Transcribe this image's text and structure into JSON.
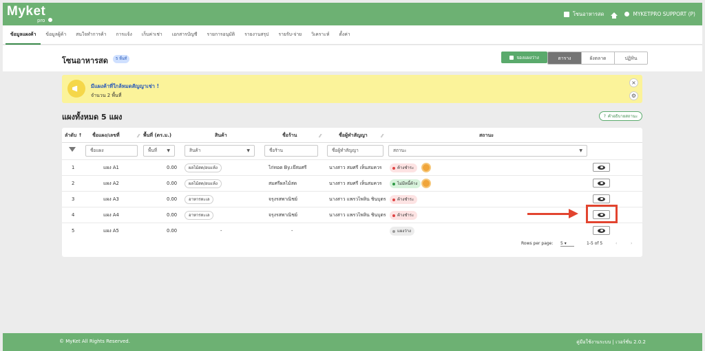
{
  "app": {
    "logo": "Myket",
    "logo_sub": "pro"
  },
  "topbar": {
    "zone": "โซนอาหารสด",
    "user": "MYKETPRO SUPPORT (P)"
  },
  "nav": [
    "ข้อมูลแผงค้า",
    "ข้อมูลผู้ค้า",
    "สนใจทำการค้า",
    "การแจ้ง",
    "เก็บค่าเช่า",
    "เอกสารบัญชี",
    "รายการอนุมัติ",
    "รายงานสรุป",
    "รายรับ-จ่าย",
    "วิเคราะห์",
    "ตั้งค่า"
  ],
  "page": {
    "title": "โซนอาหารสด",
    "badge": "5 พื้นที่",
    "reserve_btn": "จองแผงว่าง"
  },
  "view_toggle": [
    "ตาราง",
    "ผังตลาด",
    "ปฏิทิน"
  ],
  "alert": {
    "title": "มีแผงค้าที่ใกล้หมดสัญญาเช่า !",
    "subtitle": "จำนวน 2 พื้นที่"
  },
  "section": {
    "title": "แผงทั้งหมด 5 แผง",
    "help": "คำอธิบายสถานะ"
  },
  "table": {
    "headers": [
      "ลำดับ",
      "ชื่อแผง/เลขที่",
      "พื้นที่ (ตร.ม.)",
      "สินค้า",
      "ชื่อร้าน",
      "ชื่อผู้ทำสัญญา",
      "สถานะ"
    ],
    "filters": [
      "ชื่อแผง",
      "พื้นที่",
      "สินค้า",
      "ชื่อร้าน",
      "ชื่อผู้ทำสัญญา",
      "สถานะ"
    ],
    "rows": [
      {
        "no": "1",
        "name": "แผง A1",
        "area": "0.00",
        "product": "ผลไม้สด/อบแห้ง",
        "shop": "ไก่ทอด By.เจ๊สมศรี",
        "contract": "นางสาว สมศรี เห็นสมควร",
        "status": "ค้างชำระ",
        "status_color": "#e04545",
        "status_bg": "#fde3e3",
        "coin": true
      },
      {
        "no": "2",
        "name": "แผง A2",
        "area": "0.00",
        "product": "ผลไม้สด/อบแห้ง",
        "shop": "สมศรีผลไม้สด",
        "contract": "นางสาว สมศรี เห็นสมควร",
        "status": "ไม่มีหนี้ค้าง",
        "status_color": "#2f9a46",
        "status_bg": "#d8f3dc",
        "coin": true
      },
      {
        "no": "3",
        "name": "แผง A3",
        "area": "0.00",
        "product": "อาหารทะเล",
        "shop": "จรุงรสพาณิชย์",
        "contract": "นางสาว แพรวไพลิน ชินบุตร",
        "status": "ค้างชำระ",
        "status_color": "#e04545",
        "status_bg": "#fde3e3",
        "coin": false
      },
      {
        "no": "4",
        "name": "แผง A4",
        "area": "0.00",
        "product": "อาหารทะเล",
        "shop": "จรุงรสพาณิชย์",
        "contract": "นางสาว แพรวไพลิน ชินบุตร",
        "status": "ค้างชำระ",
        "status_color": "#e04545",
        "status_bg": "#fde3e3",
        "coin": false
      },
      {
        "no": "5",
        "name": "แผง A5",
        "area": "0.00",
        "product": "-",
        "shop": "-",
        "contract": "",
        "status": "แผงว่าง",
        "status_color": "#9a9a9a",
        "status_bg": "#ececec",
        "coin": false
      }
    ]
  },
  "pager": {
    "rows_label": "Rows per page:",
    "rows_value": "5",
    "range": "1-5 of 5"
  },
  "footer": {
    "left": "© MyKet All Rights Reserved.",
    "right": "คู่มือใช้งานระบบ | เวอร์ชั่น 2.0.2"
  },
  "colors": {
    "brand": "#6db173",
    "accent": "#5aaa6c",
    "highlight": "#e2442f"
  }
}
